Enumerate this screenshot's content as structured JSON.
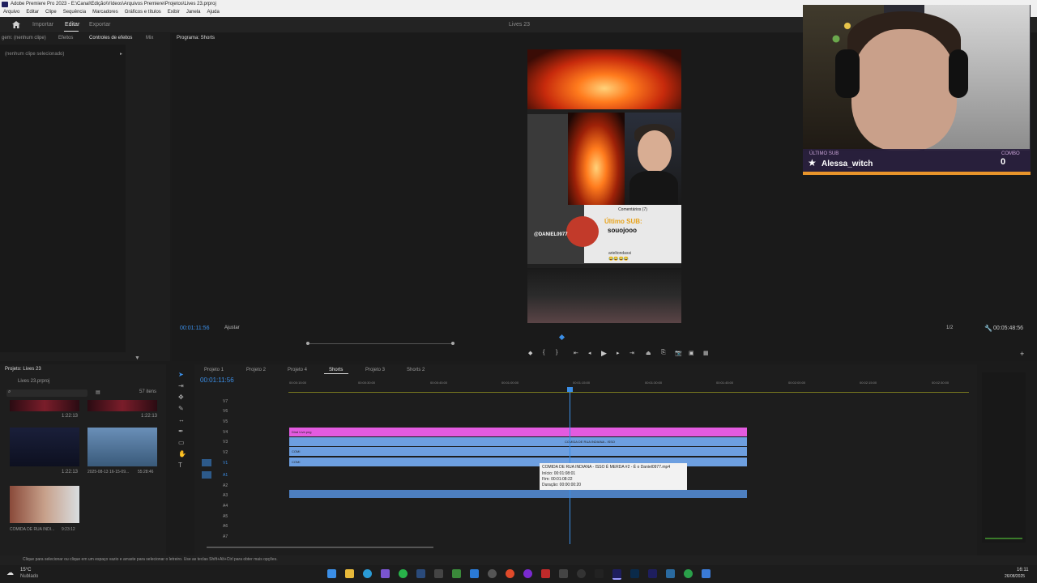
{
  "window": {
    "title": "Adobe Premiere Pro 2023 - E:\\Canal\\Edição\\Vídeos\\Arquivos Premiere\\Projetos\\Lives 23.prproj"
  },
  "menu": [
    "Arquivo",
    "Editar",
    "Clipe",
    "Sequência",
    "Marcadores",
    "Gráficos e títulos",
    "Exibir",
    "Janela",
    "Ajuda"
  ],
  "workspace": {
    "tabs": [
      "Importar",
      "Editar",
      "Exportar"
    ],
    "active": "Editar",
    "project_name": "Lives 23"
  },
  "source_panel": {
    "tabs": [
      "gem: (nenhum clipe)",
      "Efeitos",
      "Controles de efeitos",
      "Mix"
    ],
    "no_clip": "(nenhum clipe selecionado)"
  },
  "program_monitor": {
    "tab": "Programa: Shorts",
    "timecode": "00:01:11:56",
    "fit": "Ajustar",
    "resolution": "1/2",
    "duration": "00:05:48:56",
    "overlay": {
      "comments_header": "Comentários (7)",
      "sub_title": "Último SUB:",
      "sub_name": "souojooo",
      "handle": "@DANIEL0977",
      "comment_user": "arieltondassi",
      "comment_emojis": "😂😂😂😂"
    }
  },
  "webcam_overlay": {
    "label_left": "ÚLTIMO SUB",
    "username": "Alessa_witch",
    "label_right": "COMBO",
    "combo_value": "0"
  },
  "project_panel": {
    "title": "Projeto: Lives 23",
    "file": "Lives 23.prproj",
    "item_count": "57 itens",
    "thumbs": [
      {
        "duration": "1:22:13",
        "label": ""
      },
      {
        "duration": "1:22:13",
        "label": ""
      },
      {
        "duration": "1:22:13",
        "label": ""
      },
      {
        "duration": "55:28:46",
        "label": "2025-08-13 16-15-09..."
      },
      {
        "duration": "9:23:12",
        "label": "COMIDA DE RUA INDI..."
      }
    ]
  },
  "timeline": {
    "tabs": [
      "Projeto 1",
      "Projeto 2",
      "Projeto 4",
      "Shorts",
      "Projeto 3",
      "Shorts 2"
    ],
    "active_tab": "Shorts",
    "timecode": "00:01:11:56",
    "ruler": [
      "00:00:15:00",
      "00:00:30:00",
      "00:00:45:00",
      "00:01:00:00",
      "00:01:15:00",
      "00:01:30:00",
      "00:01:45:00",
      "00:02:00:00",
      "00:02:15:00",
      "00:02:30:00"
    ],
    "video_tracks": [
      "V7",
      "V6",
      "V5",
      "V4",
      "V3",
      "V2",
      "V1"
    ],
    "audio_tracks": [
      "A1",
      "A2",
      "A3",
      "A4",
      "A5",
      "A6",
      "A7"
    ],
    "clips": {
      "pink_label": "Diral Live.png",
      "blue_label": "COMIDA DE RUA INDIANA - ISSO",
      "short_label": "COMI"
    },
    "tooltip": {
      "name": "COMIDA DE RUA INDIANA - ISSO É MERDA #2 - É o Daniel0977.mp4",
      "start": "Início: 00:01:08:01",
      "end": "Fim: 00:01:08:22",
      "duration": "Duração: 00:00:00:20"
    }
  },
  "status_bar": {
    "hint": "Clique para selecionar ou clique em um espaço vazio e arraste para selecionar o letreiro. Use as teclas Shift+Alt+Ctrl para obter mais opções."
  },
  "taskbar": {
    "weather_temp": "15°C",
    "weather_desc": "Nublado",
    "time": "16:11",
    "date": "26/08/2025"
  }
}
